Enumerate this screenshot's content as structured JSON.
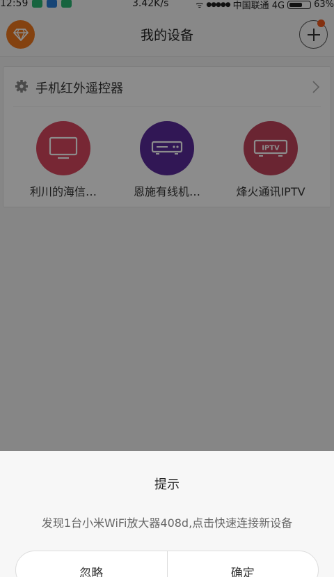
{
  "status_bar": {
    "time": "12:59",
    "speed": "3.42K/s",
    "signal": "●●●●●",
    "carrier": "中国联通 4G",
    "battery": "63%",
    "battery_fraction": 0.63
  },
  "header": {
    "title": "我的设备",
    "brand_icon": "diamond-icon",
    "add_icon": "plus-icon",
    "accent": "#f0781e"
  },
  "remote_card": {
    "title": "手机红外遥控器",
    "devices": [
      {
        "label": "利川的海信…",
        "icon": "tv-icon",
        "color": "#d9485f"
      },
      {
        "label": "恩施有线机…",
        "icon": "settop-box-icon",
        "color": "#5a2a9c"
      },
      {
        "label": "烽火通讯IPTV",
        "icon": "iptv-icon",
        "color": "#c2445c",
        "icon_text": "IPTV"
      }
    ]
  },
  "dialog": {
    "title": "提示",
    "message": "发现1台小米WiFi放大器408d,点击快速连接新设备",
    "ignore_label": "忽略",
    "confirm_label": "确定"
  }
}
